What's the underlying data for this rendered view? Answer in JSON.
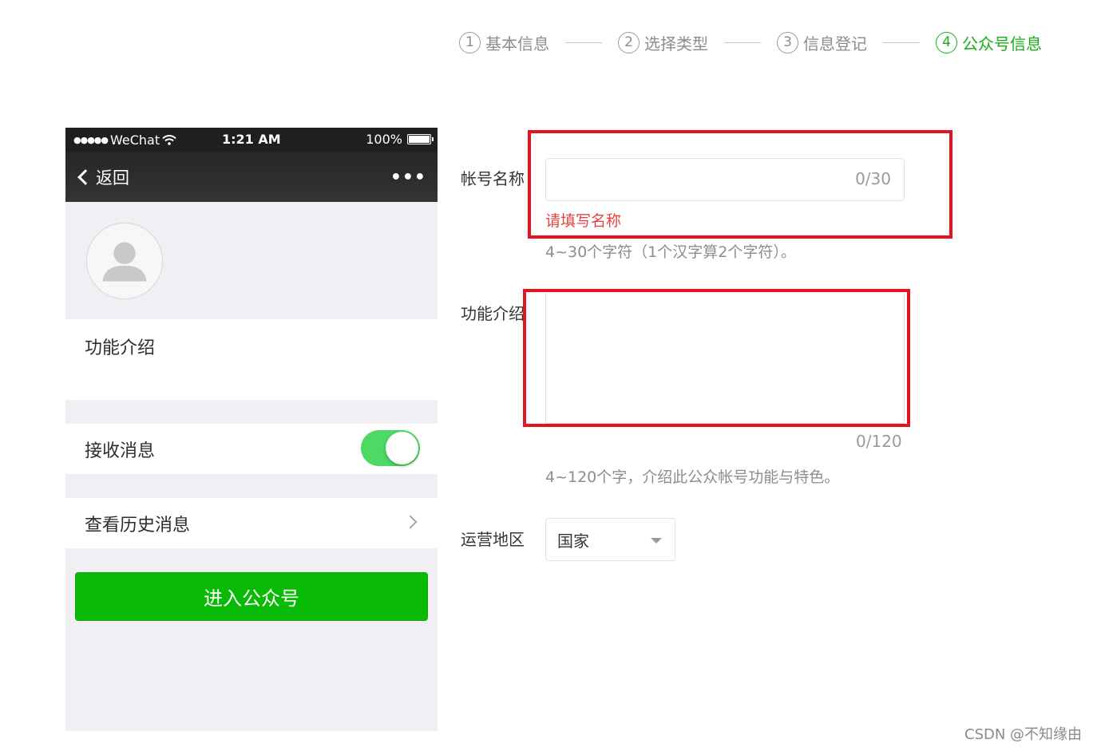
{
  "stepper": {
    "steps": [
      {
        "num": "1",
        "label": "基本信息",
        "active": false
      },
      {
        "num": "2",
        "label": "选择类型",
        "active": false
      },
      {
        "num": "3",
        "label": "信息登记",
        "active": false
      },
      {
        "num": "4",
        "label": "公众号信息",
        "active": true
      }
    ],
    "active_color": "#1aad19"
  },
  "phone": {
    "status": {
      "carrier": "WeChat",
      "time": "1:21 AM",
      "battery": "100%"
    },
    "nav": {
      "back_label": "返回",
      "more": "•••"
    },
    "intro_label": "功能介绍",
    "receive_label": "接收消息",
    "receive_on": true,
    "history_label": "查看历史消息",
    "enter_button": "进入公众号",
    "button_color": "#09bb07"
  },
  "form": {
    "name": {
      "label": "帐号名称",
      "value": "",
      "counter": "0/30",
      "error": "请填写名称",
      "hint": "4~30个字符（1个汉字算2个字符）。"
    },
    "intro": {
      "label": "功能介绍",
      "value": "",
      "counter": "0/120",
      "hint": "4~120个字，介绍此公众帐号功能与特色。"
    },
    "region": {
      "label": "运营地区",
      "selected": "国家"
    }
  },
  "highlight_color": "#e1141f",
  "watermark": "CSDN @不知缘由"
}
